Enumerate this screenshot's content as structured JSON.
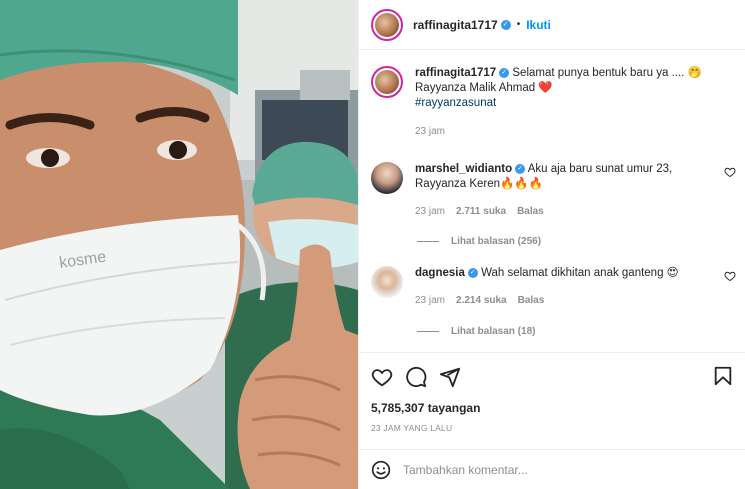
{
  "header": {
    "username": "raffinagita1717",
    "separator": "•",
    "follow_label": "Ikuti"
  },
  "caption": {
    "username": "raffinagita1717",
    "text_line1": "Selamat punya bentuk baru ya .... 🤭",
    "text_line2": "Rayyanza Malik Ahmad ❤️",
    "hashtag": "#rayyanzasunat",
    "time": "23 jam"
  },
  "comments": [
    {
      "username": "marshel_widianto",
      "text": "Aku aja baru sunat umur 23, Rayyanza Keren🔥🔥🔥",
      "time": "23 jam",
      "likes": "2.711 suka",
      "reply_label": "Balas",
      "view_replies": "Lihat balasan (256)"
    },
    {
      "username": "dagnesia",
      "text": "Wah selamat dikhitan anak ganteng 😍",
      "time": "23 jam",
      "likes": "2.214 suka",
      "reply_label": "Balas",
      "view_replies": "Lihat balasan (18)"
    }
  ],
  "actions": {
    "views": "5,785,307 tayangan",
    "timestamp": "23 JAM YANG LALU"
  },
  "add_comment": {
    "placeholder": "Tambahkan komentar..."
  },
  "media": {
    "mask_brand": "kosme"
  },
  "colors": {
    "link": "#0095f6",
    "verified": "#3897f0",
    "muted": "#8e8e8e",
    "scrub_cap": "#4fa88e"
  },
  "icons": [
    "verified-badge-icon",
    "heart-icon",
    "comment-icon",
    "share-icon",
    "bookmark-icon",
    "emoji-icon"
  ]
}
